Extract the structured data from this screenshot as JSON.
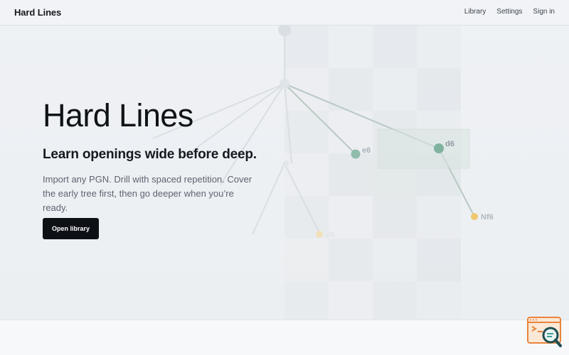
{
  "header": {
    "brand": "Hard Lines",
    "nav": [
      {
        "label": "Library"
      },
      {
        "label": "Settings"
      },
      {
        "label": "Sign in"
      }
    ]
  },
  "hero": {
    "title": "Hard Lines",
    "subtitle": "Learn openings wide before deep.",
    "description": "Import any PGN. Drill with spaced repetition. Cover the early tree first, then go deeper when you’re ready.",
    "cta_label": "Open library"
  },
  "tree_labels": {
    "e6": "e6",
    "d6": "d6",
    "nf6": "Nf6",
    "left_move": "d6"
  },
  "colors": {
    "accent_green": "#7fb3a0",
    "accent_yellow": "#f0c870",
    "button": "#0d1014"
  },
  "icons": {
    "badge": "search-console-icon"
  }
}
